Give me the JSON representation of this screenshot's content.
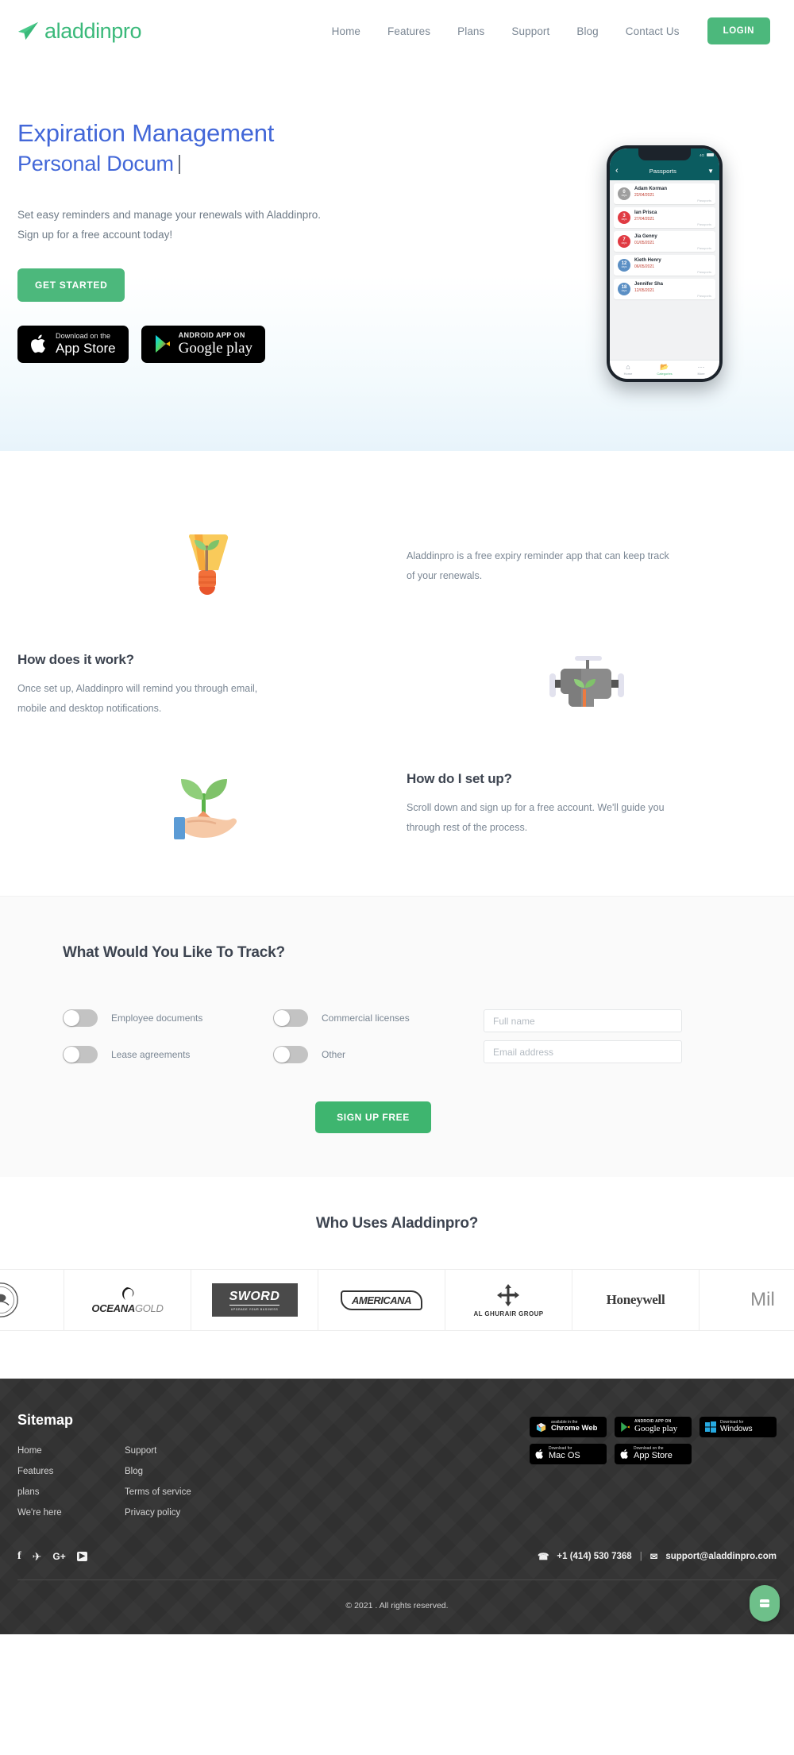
{
  "header": {
    "brand": "aladdinpro",
    "brand_icon": "paper-plane-icon",
    "nav": [
      {
        "label": "Home"
      },
      {
        "label": "Features"
      },
      {
        "label": "Plans"
      },
      {
        "label": "Support"
      },
      {
        "label": "Blog"
      },
      {
        "label": "Contact Us"
      }
    ],
    "login_label": "LOGIN",
    "accent": "#4cb87c"
  },
  "hero": {
    "title_line1": "Expiration Management",
    "title_line2": "Personal Docum",
    "title_color": "#4267d8",
    "subtitle_line1": "Set easy reminders and manage your renewals with Aladdinpro.",
    "subtitle_line2": "Sign up for a free account today!",
    "cta_label": "GET STARTED",
    "badges": [
      {
        "top": "Download on the",
        "bottom": "App Store",
        "icon": "apple-icon"
      },
      {
        "top": "ANDROID APP ON",
        "bottom": "Google play",
        "icon": "google-play-icon"
      }
    ]
  },
  "phone": {
    "status_text": "4G",
    "appbar_title": "Passports",
    "back_icon": "chevron-left-icon",
    "filter_icon": "filter-icon",
    "items": [
      {
        "days": "0",
        "unit": "days",
        "name": "Adam Korman",
        "date": "22/04/2021",
        "tag": "Passports",
        "color": "#9e9e9e"
      },
      {
        "days": "3",
        "unit": "days",
        "name": "Ian Prisca",
        "date": "27/04/2021",
        "tag": "Passports",
        "color": "#e03b43"
      },
      {
        "days": "7",
        "unit": "days",
        "name": "Jia Genny",
        "date": "01/05/2021",
        "tag": "Passports",
        "color": "#e03b43"
      },
      {
        "days": "12",
        "unit": "days",
        "name": "Kieth Henry",
        "date": "06/05/2021",
        "tag": "Passports",
        "color": "#5b8fc4"
      },
      {
        "days": "18",
        "unit": "days",
        "name": "Jennifer Sha",
        "date": "12/05/2021",
        "tag": "Passports",
        "color": "#5b8fc4"
      }
    ],
    "tabs": [
      {
        "label": "Home",
        "icon": "home-icon"
      },
      {
        "label": "Categories",
        "icon": "folder-icon"
      },
      {
        "label": "More",
        "icon": "more-icon"
      }
    ]
  },
  "features": [
    {
      "art": "lightbulb-sprout-icon",
      "title": "",
      "body": "Aladdinpro is a free expiry reminder app that can keep track of your renewals."
    },
    {
      "art": "engine-sprout-icon",
      "title": "How does it work?",
      "body": "Once set up, Aladdinpro will remind you through email, mobile and desktop notifications."
    },
    {
      "art": "hand-sprout-icon",
      "title": "How do I set up?",
      "body": "Scroll down and sign up for a free account. We'll guide you through rest of the process."
    }
  ],
  "track": {
    "heading": "What Would You Like To Track?",
    "toggles": [
      {
        "label": "Employee documents",
        "on": false
      },
      {
        "label": "Commercial licenses",
        "on": false
      },
      {
        "label": "Lease agreements",
        "on": false
      },
      {
        "label": "Other",
        "on": false
      }
    ],
    "fields": [
      {
        "placeholder": "Full name",
        "value": ""
      },
      {
        "placeholder": "Email address",
        "value": ""
      }
    ],
    "submit_label": "SIGN UP FREE"
  },
  "clients": {
    "heading": "Who Uses Aladdinpro?",
    "logos": [
      {
        "name": "government-seal-logo",
        "text": ""
      },
      {
        "name": "oceanagold-logo",
        "text": "OCEANA",
        "text2": "GOLD"
      },
      {
        "name": "sword-logo",
        "text": "SWORD",
        "text2": "UPGRADE YOUR BUSINESS"
      },
      {
        "name": "americana-logo",
        "text": "AMERICANA"
      },
      {
        "name": "al-ghurair-group-logo",
        "text": "AL GHURAIR GROUP"
      },
      {
        "name": "honeywell-logo",
        "text": "Honeywell"
      },
      {
        "name": "mil-logo",
        "text": "Mil"
      }
    ]
  },
  "footer": {
    "sitemap_title": "Sitemap",
    "links_col1": [
      {
        "label": "Home"
      },
      {
        "label": "Features"
      },
      {
        "label": "plans"
      },
      {
        "label": "We're here"
      }
    ],
    "links_col2": [
      {
        "label": "Support"
      },
      {
        "label": "Blog"
      },
      {
        "label": "Terms of service"
      },
      {
        "label": "Privacy policy"
      }
    ],
    "downloads": [
      {
        "top": "available in the",
        "bottom": "Chrome Web",
        "icon": "chrome-web-store-icon"
      },
      {
        "top": "ANDROID APP ON",
        "bottom": "Google play",
        "icon": "google-play-icon"
      },
      {
        "top": "Download for",
        "bottom": "Windows",
        "icon": "windows-icon"
      },
      {
        "top": "Download for",
        "bottom": "Mac OS",
        "icon": "apple-icon"
      },
      {
        "top": "Download on the",
        "bottom": "App Store",
        "icon": "apple-icon"
      }
    ],
    "socials": [
      {
        "name": "facebook-icon",
        "glyph": "f"
      },
      {
        "name": "twitter-icon",
        "glyph": "✈"
      },
      {
        "name": "google-plus-icon",
        "glyph": "G+"
      },
      {
        "name": "youtube-icon",
        "glyph": "▶"
      }
    ],
    "phone": "+1 (414) 530 7368",
    "phone_icon": "phone-icon",
    "separator": "|",
    "email": "support@aladdinpro.com",
    "email_icon": "envelope-icon",
    "copyright": "© 2021 .   All rights reserved.",
    "chat_icon": "chat-bubble-icon"
  }
}
